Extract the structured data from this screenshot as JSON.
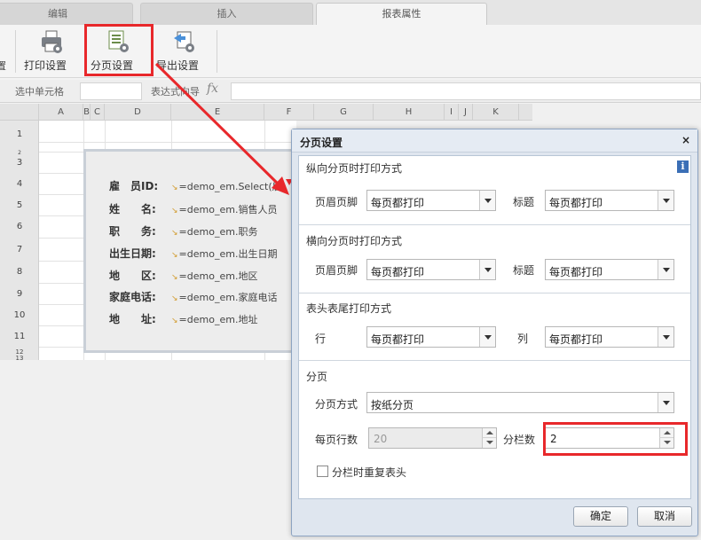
{
  "tabs": [
    "编辑",
    "插入",
    "报表属性"
  ],
  "ribbon": {
    "left_cut_label": "置",
    "print_settings": "打印设置",
    "page_settings": "分页设置",
    "export_settings": "导出设置"
  },
  "formula_bar": {
    "selected_cell_label": "选中单元格",
    "wizard_label": "表达式向导",
    "fx": "fx"
  },
  "sheet": {
    "columns": [
      "A",
      "B",
      "C",
      "D",
      "E",
      "F",
      "G",
      "H",
      "I",
      "J",
      "K"
    ],
    "rows": [
      "1",
      "2",
      "3",
      "4",
      "5",
      "6",
      "7",
      "8",
      "9",
      "10",
      "11",
      "12",
      "13"
    ],
    "fields": [
      {
        "label": "雇　员ID:",
        "value": "=demo_em.Select(雇"
      },
      {
        "label": "姓　　名:",
        "value": "=demo_em.销售人员"
      },
      {
        "label": "职　　务:",
        "value": "=demo_em.职务"
      },
      {
        "label": "出生日期:",
        "value": "=demo_em.出生日期"
      },
      {
        "label": "地　　区:",
        "value": "=demo_em.地区"
      },
      {
        "label": "家庭电话:",
        "value": "=demo_em.家庭电话"
      },
      {
        "label": "地　　址:",
        "value": "=demo_em.地址"
      }
    ]
  },
  "dialog": {
    "title": "分页设置",
    "close": "×",
    "vertical": {
      "title": "纵向分页时打印方式",
      "header_footer_label": "页眉页脚",
      "header_footer_value": "每页都打印",
      "title_label": "标题",
      "title_value": "每页都打印"
    },
    "horizontal": {
      "title": "横向分页时打印方式",
      "header_footer_label": "页眉页脚",
      "header_footer_value": "每页都打印",
      "title_label": "标题",
      "title_value": "每页都打印"
    },
    "table_head": {
      "title": "表头表尾打印方式",
      "row_label": "行",
      "row_value": "每页都打印",
      "col_label": "列",
      "col_value": "每页都打印"
    },
    "paging": {
      "title": "分页",
      "mode_label": "分页方式",
      "mode_value": "按纸分页",
      "rows_per_page_label": "每页行数",
      "rows_per_page_value": "20",
      "columns_label": "分栏数",
      "columns_value": "2",
      "repeat_header_label": "分栏时重复表头",
      "repeat_header_checked": false
    },
    "ok": "确定",
    "cancel": "取消"
  },
  "colors": {
    "highlight": "#e8282b",
    "dialog_border": "#8da4c2"
  }
}
